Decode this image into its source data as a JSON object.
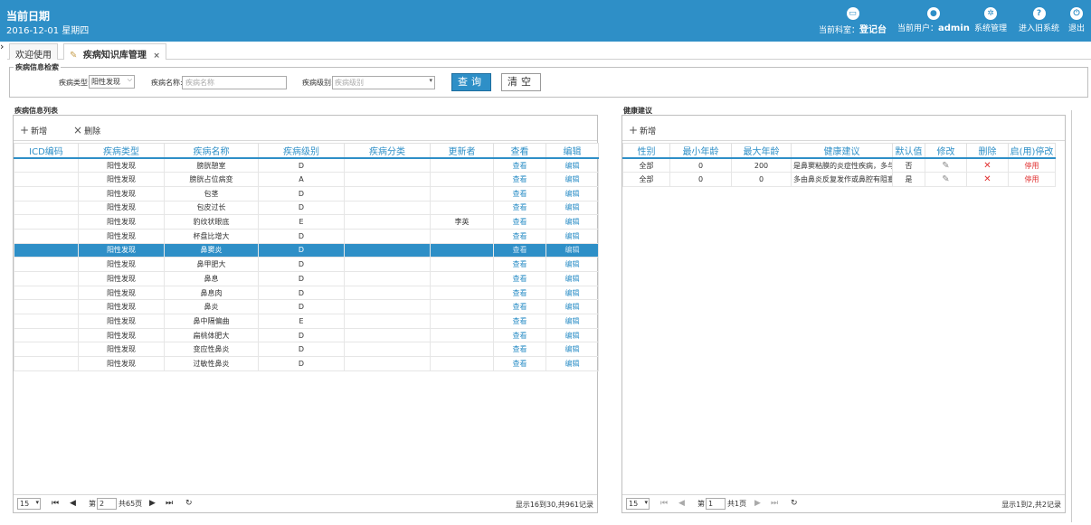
{
  "header": {
    "date_title": "当前日期",
    "date_value": "2016-12-01 星期四",
    "dept_label": "当前科室：",
    "dept_value": "登记台",
    "user_label": "当前用户：",
    "user_value": "admin",
    "system_mgmt": "系统管理",
    "old_system": "进入旧系统",
    "logout": "退出"
  },
  "tabs": [
    {
      "label": "欢迎使用"
    },
    {
      "label": "疾病知识库管理",
      "close": "×"
    }
  ],
  "search": {
    "legend": "疾病信息检索",
    "type_label": "疾病类型:",
    "type_value": "阳性发现",
    "name_label": "疾病名称:",
    "name_placeholder": "疾病名称",
    "level_label": "疾病级别:",
    "level_placeholder": "疾病级别",
    "query_button": "查询",
    "clear_button": "清空"
  },
  "disease_list": {
    "legend": "疾病信息列表",
    "add_label": "新增",
    "delete_label": "删除",
    "columns": [
      "ICD编码",
      "疾病类型",
      "疾病名称",
      "疾病级别",
      "疾病分类",
      "更新者",
      "查看",
      "编辑"
    ],
    "rows": [
      {
        "icd": "",
        "type": "阳性发现",
        "name": "膀胱憩室",
        "level": "D",
        "category": "",
        "updater": "",
        "view": "查看",
        "edit": "编辑"
      },
      {
        "icd": "",
        "type": "阳性发现",
        "name": "膀胱占位病变",
        "level": "A",
        "category": "",
        "updater": "",
        "view": "查看",
        "edit": "编辑"
      },
      {
        "icd": "",
        "type": "阳性发现",
        "name": "包茎",
        "level": "D",
        "category": "",
        "updater": "",
        "view": "查看",
        "edit": "编辑"
      },
      {
        "icd": "",
        "type": "阳性发现",
        "name": "包皮过长",
        "level": "D",
        "category": "",
        "updater": "",
        "view": "查看",
        "edit": "编辑"
      },
      {
        "icd": "",
        "type": "阳性发现",
        "name": "豹纹状眼底",
        "level": "E",
        "category": "",
        "updater": "李英",
        "view": "查看",
        "edit": "编辑"
      },
      {
        "icd": "",
        "type": "阳性发现",
        "name": "杯盘比增大",
        "level": "D",
        "category": "",
        "updater": "",
        "view": "查看",
        "edit": "编辑"
      },
      {
        "icd": "",
        "type": "阳性发现",
        "name": "鼻窦炎",
        "level": "D",
        "category": "",
        "updater": "",
        "view": "查看",
        "edit": "编辑"
      },
      {
        "icd": "",
        "type": "阳性发现",
        "name": "鼻甲肥大",
        "level": "D",
        "category": "",
        "updater": "",
        "view": "查看",
        "edit": "编辑"
      },
      {
        "icd": "",
        "type": "阳性发现",
        "name": "鼻息",
        "level": "D",
        "category": "",
        "updater": "",
        "view": "查看",
        "edit": "编辑"
      },
      {
        "icd": "",
        "type": "阳性发现",
        "name": "鼻息肉",
        "level": "D",
        "category": "",
        "updater": "",
        "view": "查看",
        "edit": "编辑"
      },
      {
        "icd": "",
        "type": "阳性发现",
        "name": "鼻炎",
        "level": "D",
        "category": "",
        "updater": "",
        "view": "查看",
        "edit": "编辑"
      },
      {
        "icd": "",
        "type": "阳性发现",
        "name": "鼻中隔偏曲",
        "level": "E",
        "category": "",
        "updater": "",
        "view": "查看",
        "edit": "编辑"
      },
      {
        "icd": "",
        "type": "阳性发现",
        "name": "扁桃体肥大",
        "level": "D",
        "category": "",
        "updater": "",
        "view": "查看",
        "edit": "编辑"
      },
      {
        "icd": "",
        "type": "阳性发现",
        "name": "变应性鼻炎",
        "level": "D",
        "category": "",
        "updater": "",
        "view": "查看",
        "edit": "编辑"
      },
      {
        "icd": "",
        "type": "阳性发现",
        "name": "过敏性鼻炎",
        "level": "D",
        "category": "",
        "updater": "",
        "view": "查看",
        "edit": "编辑"
      }
    ],
    "selected_index": 6,
    "pager": {
      "page_size": "15",
      "page_prefix": "第",
      "current_page": "2",
      "total_pages": "共65页",
      "info": "显示16到30,共961记录"
    }
  },
  "health_advice": {
    "legend": "健康建议",
    "add_label": "新增",
    "columns": [
      "性别",
      "最小年龄",
      "最大年龄",
      "健康建议",
      "默认值",
      "修改",
      "删除",
      "启(用)停改"
    ],
    "rows": [
      {
        "gender": "全部",
        "min_age": "0",
        "max_age": "200",
        "advice": "是鼻窦粘膜的炎症性疾病，多与鼻",
        "default": "否",
        "status": "停用"
      },
      {
        "gender": "全部",
        "min_age": "0",
        "max_age": "0",
        "advice": "多由鼻炎反复发作或鼻腔有阻塞性",
        "default": "是",
        "status": "停用"
      }
    ],
    "pager": {
      "page_size": "15",
      "page_prefix": "第",
      "current_page": "1",
      "total_pages": "共1页",
      "info": "显示1到2,共2记录"
    }
  },
  "colors": {
    "accent": "#2e8fc7",
    "danger": "#e03030"
  }
}
